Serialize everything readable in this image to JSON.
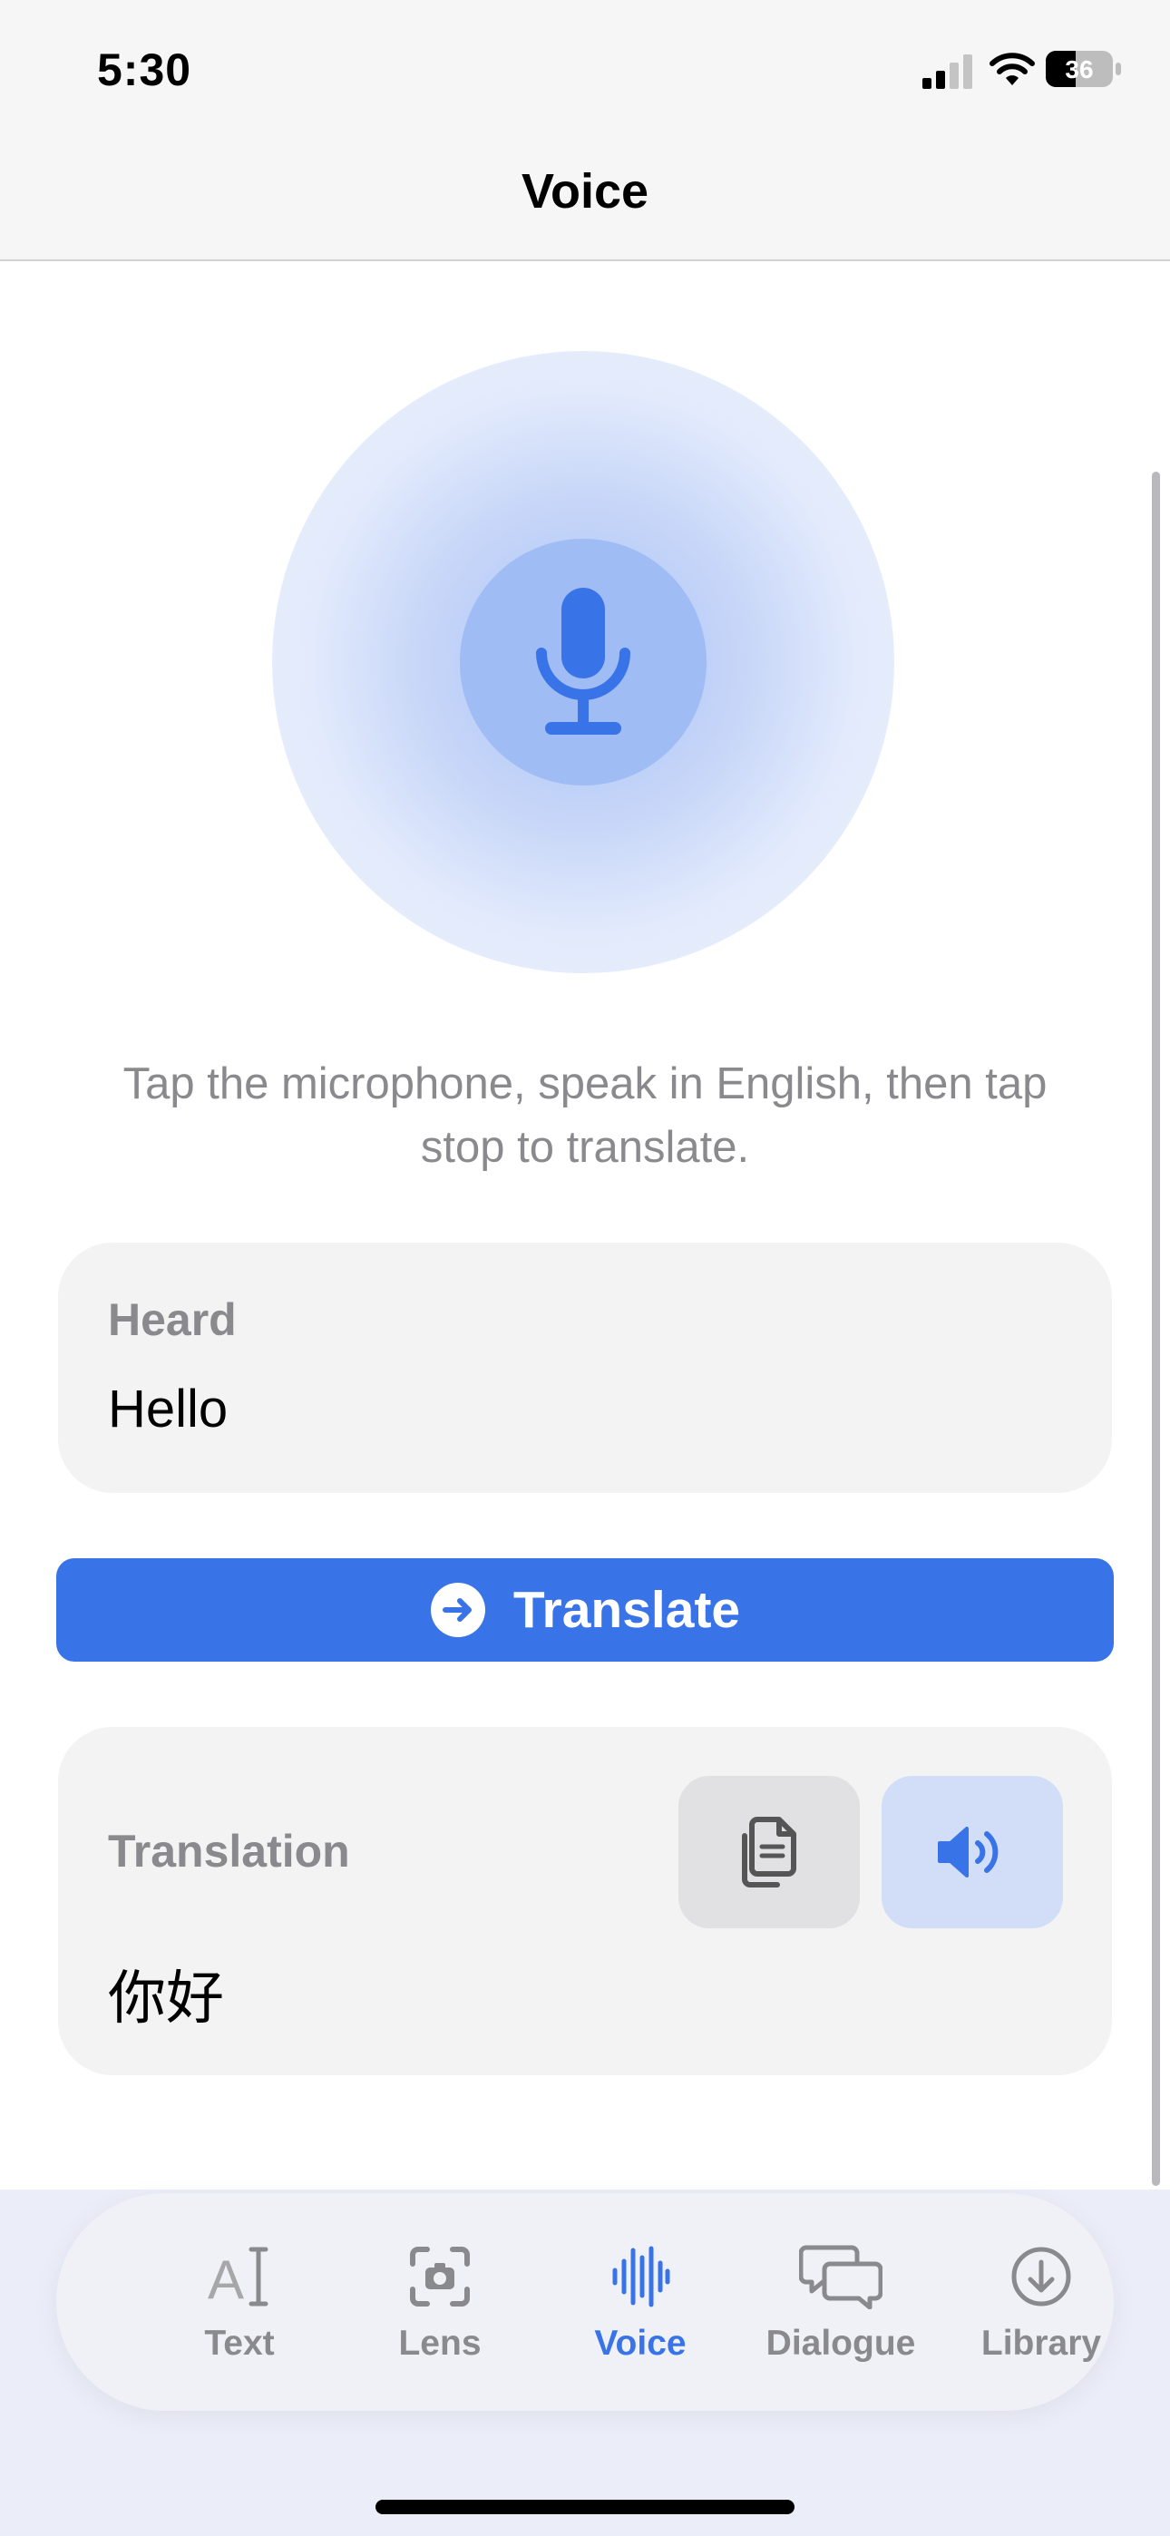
{
  "status_bar": {
    "time": "5:30",
    "battery_level": "36",
    "icons": [
      "cellular-signal-icon",
      "wifi-icon",
      "battery-icon"
    ]
  },
  "header": {
    "title": "Voice"
  },
  "microphone": {
    "icon": "microphone-icon"
  },
  "instruction": "Tap the microphone, speak in English, then tap stop to translate.",
  "heard": {
    "label": "Heard",
    "text": "Hello"
  },
  "translate_button": {
    "icon": "arrow-right-circle-icon",
    "label": "Translate"
  },
  "translation": {
    "label": "Translation",
    "text": "你好",
    "copy_icon": "copy-icon",
    "speak_icon": "speaker-icon"
  },
  "tabs": [
    {
      "label": "Text",
      "icon": "text-cursor-icon",
      "active": false
    },
    {
      "label": "Lens",
      "icon": "camera-viewfinder-icon",
      "active": false
    },
    {
      "label": "Voice",
      "icon": "waveform-icon",
      "active": true
    },
    {
      "label": "Dialogue",
      "icon": "speech-bubbles-icon",
      "active": false
    },
    {
      "label": "Library",
      "icon": "download-circle-icon",
      "active": false
    }
  ],
  "colors": {
    "accent": "#3873e7",
    "card_background": "#f3f3f4",
    "secondary_text": "#8a8a8e",
    "mic_halo": "#c8d7f8",
    "mic_button": "#9fbcf4"
  }
}
